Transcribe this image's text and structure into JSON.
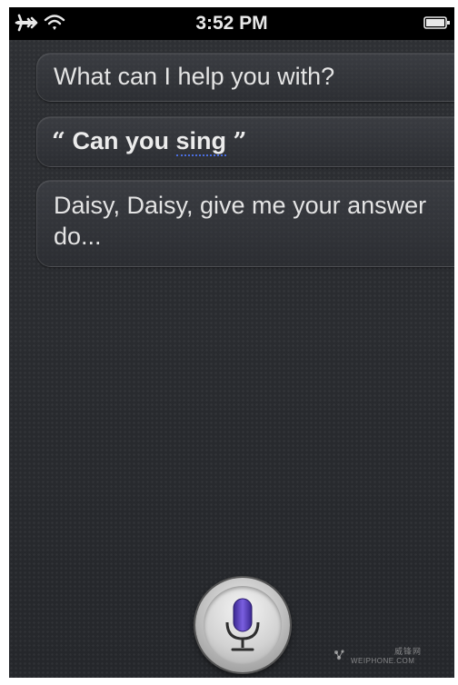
{
  "status_bar": {
    "time": "3:52 PM",
    "icons": [
      "airplane-mode-icon",
      "wifi-icon",
      "battery-icon"
    ]
  },
  "conversation": {
    "siri_prompt": "What can I help you with?",
    "user_query": {
      "open_quote": "“",
      "prefix": "Can you ",
      "underlined_word": "sing",
      "close_quote": "”"
    },
    "siri_reply": "Daisy, Daisy, give me your answer do..."
  },
  "mic_button": {
    "icon": "microphone-icon",
    "accent_color": "#5b3fbf"
  },
  "watermark": {
    "text_cn": "威锋网",
    "text_en": "WEIPHONE.COM"
  },
  "colors": {
    "background": "#2b2d31",
    "status_bar": "#000000",
    "text": "#e4e4e4",
    "underline": "#4a6ee0"
  }
}
